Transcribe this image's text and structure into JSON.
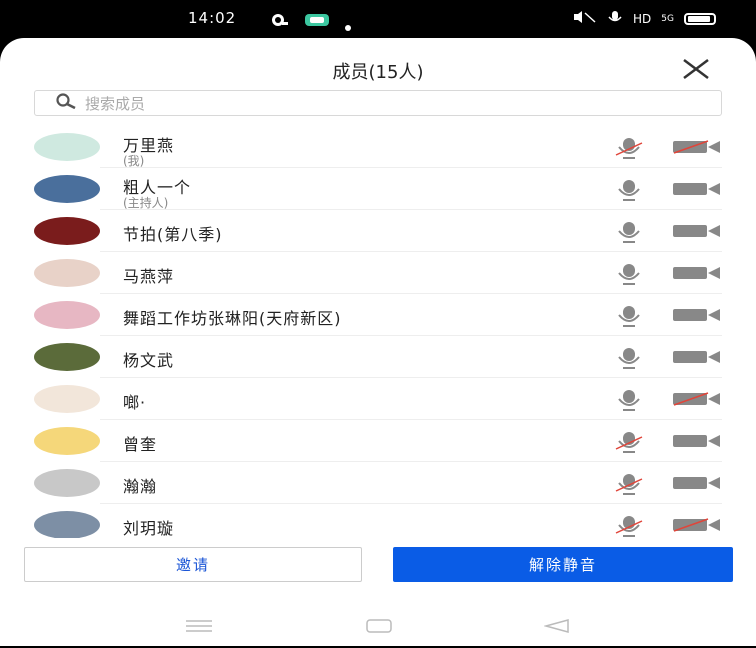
{
  "status": {
    "time": "14:02",
    "right_text": "HD",
    "network": "5G"
  },
  "sheet": {
    "title": "成员(15人)",
    "search_placeholder": "搜索成员"
  },
  "members": [
    {
      "name": "万里燕",
      "sub": "(我)",
      "mic_muted": true,
      "cam_off": true,
      "avatar_color": "#cfe9e0"
    },
    {
      "name": "粗人一个",
      "sub": "(主持人)",
      "mic_muted": false,
      "cam_off": false,
      "avatar_color": "#4a6f9c"
    },
    {
      "name": "节拍(第八季)",
      "sub": "",
      "mic_muted": false,
      "cam_off": false,
      "avatar_color": "#7a1c1c"
    },
    {
      "name": "马燕萍",
      "sub": "",
      "mic_muted": false,
      "cam_off": false,
      "avatar_color": "#e8d2c8"
    },
    {
      "name": "舞蹈工作坊张琳阳(天府新区)",
      "sub": "",
      "mic_muted": false,
      "cam_off": false,
      "avatar_color": "#e7b7c3"
    },
    {
      "name": "杨文武",
      "sub": "",
      "mic_muted": false,
      "cam_off": false,
      "avatar_color": "#5b6b3a"
    },
    {
      "name": "啷·",
      "sub": "",
      "mic_muted": false,
      "cam_off": true,
      "avatar_color": "#f2e6da"
    },
    {
      "name": "曾奎",
      "sub": "",
      "mic_muted": true,
      "cam_off": false,
      "avatar_color": "#f5d77a"
    },
    {
      "name": "瀚瀚",
      "sub": "",
      "mic_muted": true,
      "cam_off": false,
      "avatar_color": "#c8c8c8"
    },
    {
      "name": "刘玥璇",
      "sub": "",
      "mic_muted": true,
      "cam_off": true,
      "avatar_color": "#7d8fa5"
    }
  ],
  "buttons": {
    "invite": "邀请",
    "unmute_all": "解除静音"
  },
  "colors": {
    "accent": "#0a5ce6",
    "muted_slash": "#e0453a",
    "icon_gray": "#888888"
  }
}
